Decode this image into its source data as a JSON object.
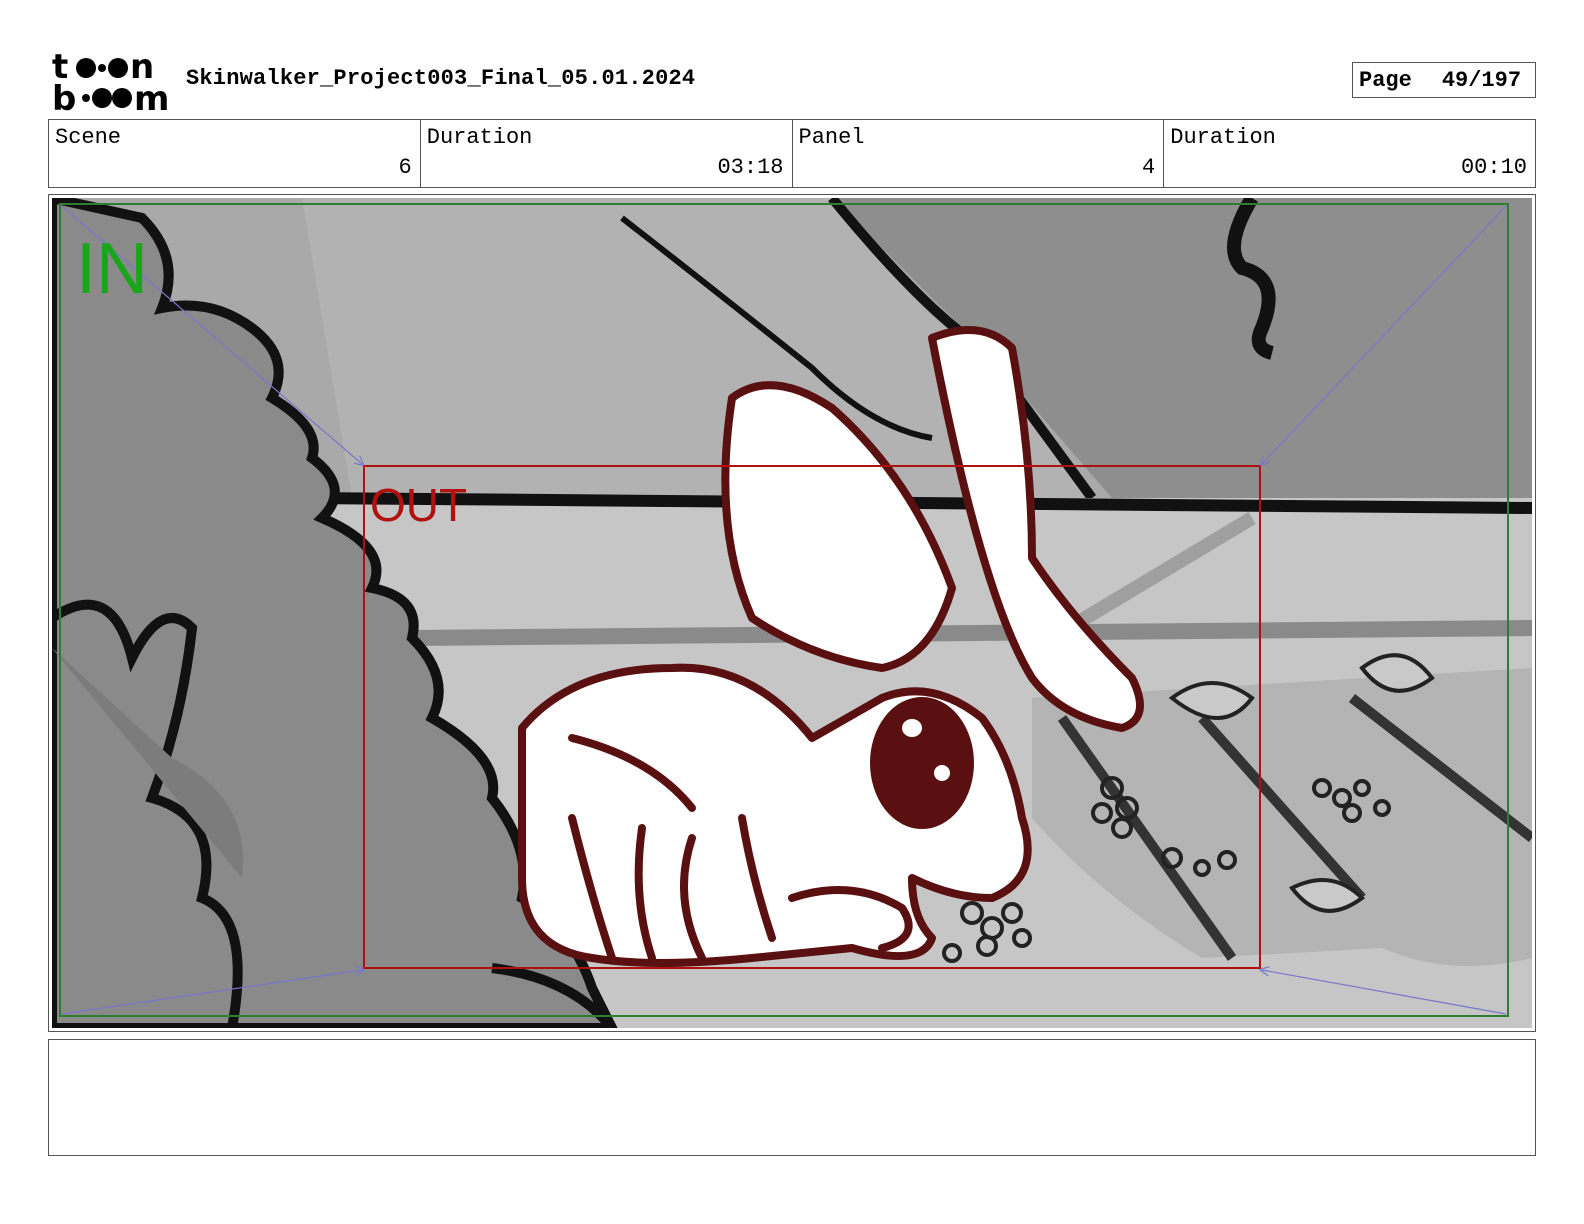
{
  "header": {
    "logo_text": "toon boom",
    "document_title": "Skinwalker_Project003_Final_05.01.2024",
    "page_label": "Page",
    "page_value": "49/197"
  },
  "info": {
    "scene_label": "Scene",
    "scene_value": "6",
    "duration_label": "Duration",
    "duration_value": "03:18",
    "panel_label": "Panel",
    "panel_value": "4",
    "panel_duration_label": "Duration",
    "panel_duration_value": "00:10"
  },
  "panel": {
    "in_label": "IN",
    "out_label": "OUT",
    "in_color": "#1aa61a",
    "out_color": "#b01010",
    "line_color": "#5a1010"
  },
  "notes": {
    "text": ""
  }
}
